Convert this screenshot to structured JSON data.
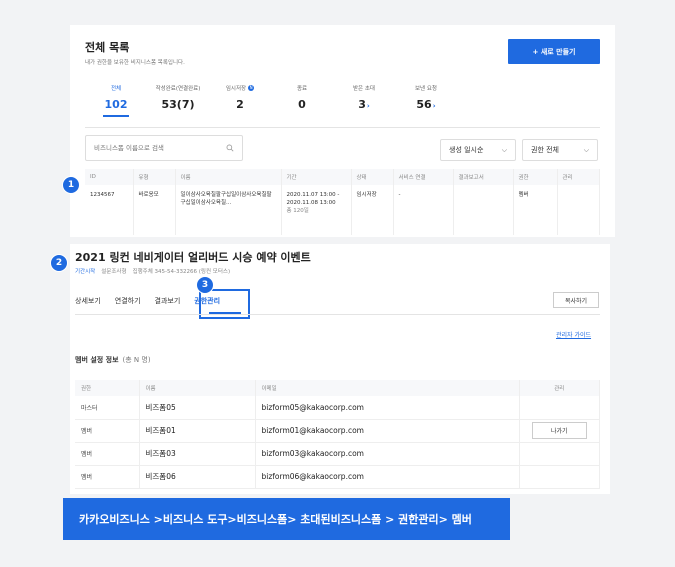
{
  "panel1": {
    "title": "전체 목록",
    "subtitle": "내가 권한을 보유한 비지니스폼 목록입니다.",
    "new_button": "+ 새로 만들기",
    "stats": [
      {
        "label": "전체",
        "value": "102",
        "active": true
      },
      {
        "label": "작성완료(연결완료)",
        "value": "53(7)"
      },
      {
        "label": "임시저장",
        "value": "2",
        "badge": "N"
      },
      {
        "label": "종료",
        "value": "0"
      },
      {
        "label": "받은 초대",
        "value": "3",
        "arrow": "›"
      },
      {
        "label": "보낸 요청",
        "value": "56",
        "arrow": "›"
      }
    ],
    "search_placeholder": "비즈니스폼 이름으로 검색",
    "sort_dropdown": "생성 일시순",
    "permission_dropdown": "권한 전체",
    "table_headers": [
      "ID",
      "유형",
      "이름",
      "기간",
      "상태",
      "서비스 연결",
      "결과보고서",
      "권한",
      "관리"
    ],
    "row": {
      "id": "1234567",
      "type": "바로응모",
      "name": "일이삼사오육칠팔구십일이삼사오육칠팔구십일이삼사오육칠...",
      "period_start": "2020.11.07 13:00 -",
      "period_end": "2020.11.08 13:00",
      "period_days": "총 120일",
      "status": "임시저장",
      "service": "-",
      "report": "",
      "permission": "멤버",
      "manage": ""
    }
  },
  "markers": [
    "1",
    "2",
    "3"
  ],
  "panel2": {
    "title": "2021 링컨 네비게이터 얼리버드 시승 예약 이벤트",
    "meta_link": "기간시작",
    "meta_type": "설문조사형",
    "meta_manager": "집행주체 345-54-332266 (링컨 모터스)",
    "tabs": [
      "상세보기",
      "연결하기",
      "결과보기",
      "권한관리"
    ],
    "copy_button": "복사하기",
    "admin_guide": "관리자 가이드",
    "member_title": "멤버 설정 정보",
    "member_count": "(총 N 명)",
    "table_headers": [
      "권한",
      "이름",
      "이메일",
      "관리"
    ],
    "members": [
      {
        "role": "마스터",
        "name": "비즈폼05",
        "email": "bizform05@kakaocorp.com",
        "action": ""
      },
      {
        "role": "멤버",
        "name": "비즈폼01",
        "email": "bizform01@kakaocorp.com",
        "action": "나가기"
      },
      {
        "role": "멤버",
        "name": "비즈폼03",
        "email": "bizform03@kakaocorp.com",
        "action": ""
      },
      {
        "role": "멤버",
        "name": "비즈폼06",
        "email": "bizform06@kakaocorp.com",
        "action": ""
      }
    ]
  },
  "banner": "카카오비즈니스 >비즈니스 도구>비즈니스폼> 초대된비즈니스폼 > 권한관리> 멤버",
  "colors": {
    "accent": "#1f6ae0",
    "background": "#f2f3f5"
  }
}
